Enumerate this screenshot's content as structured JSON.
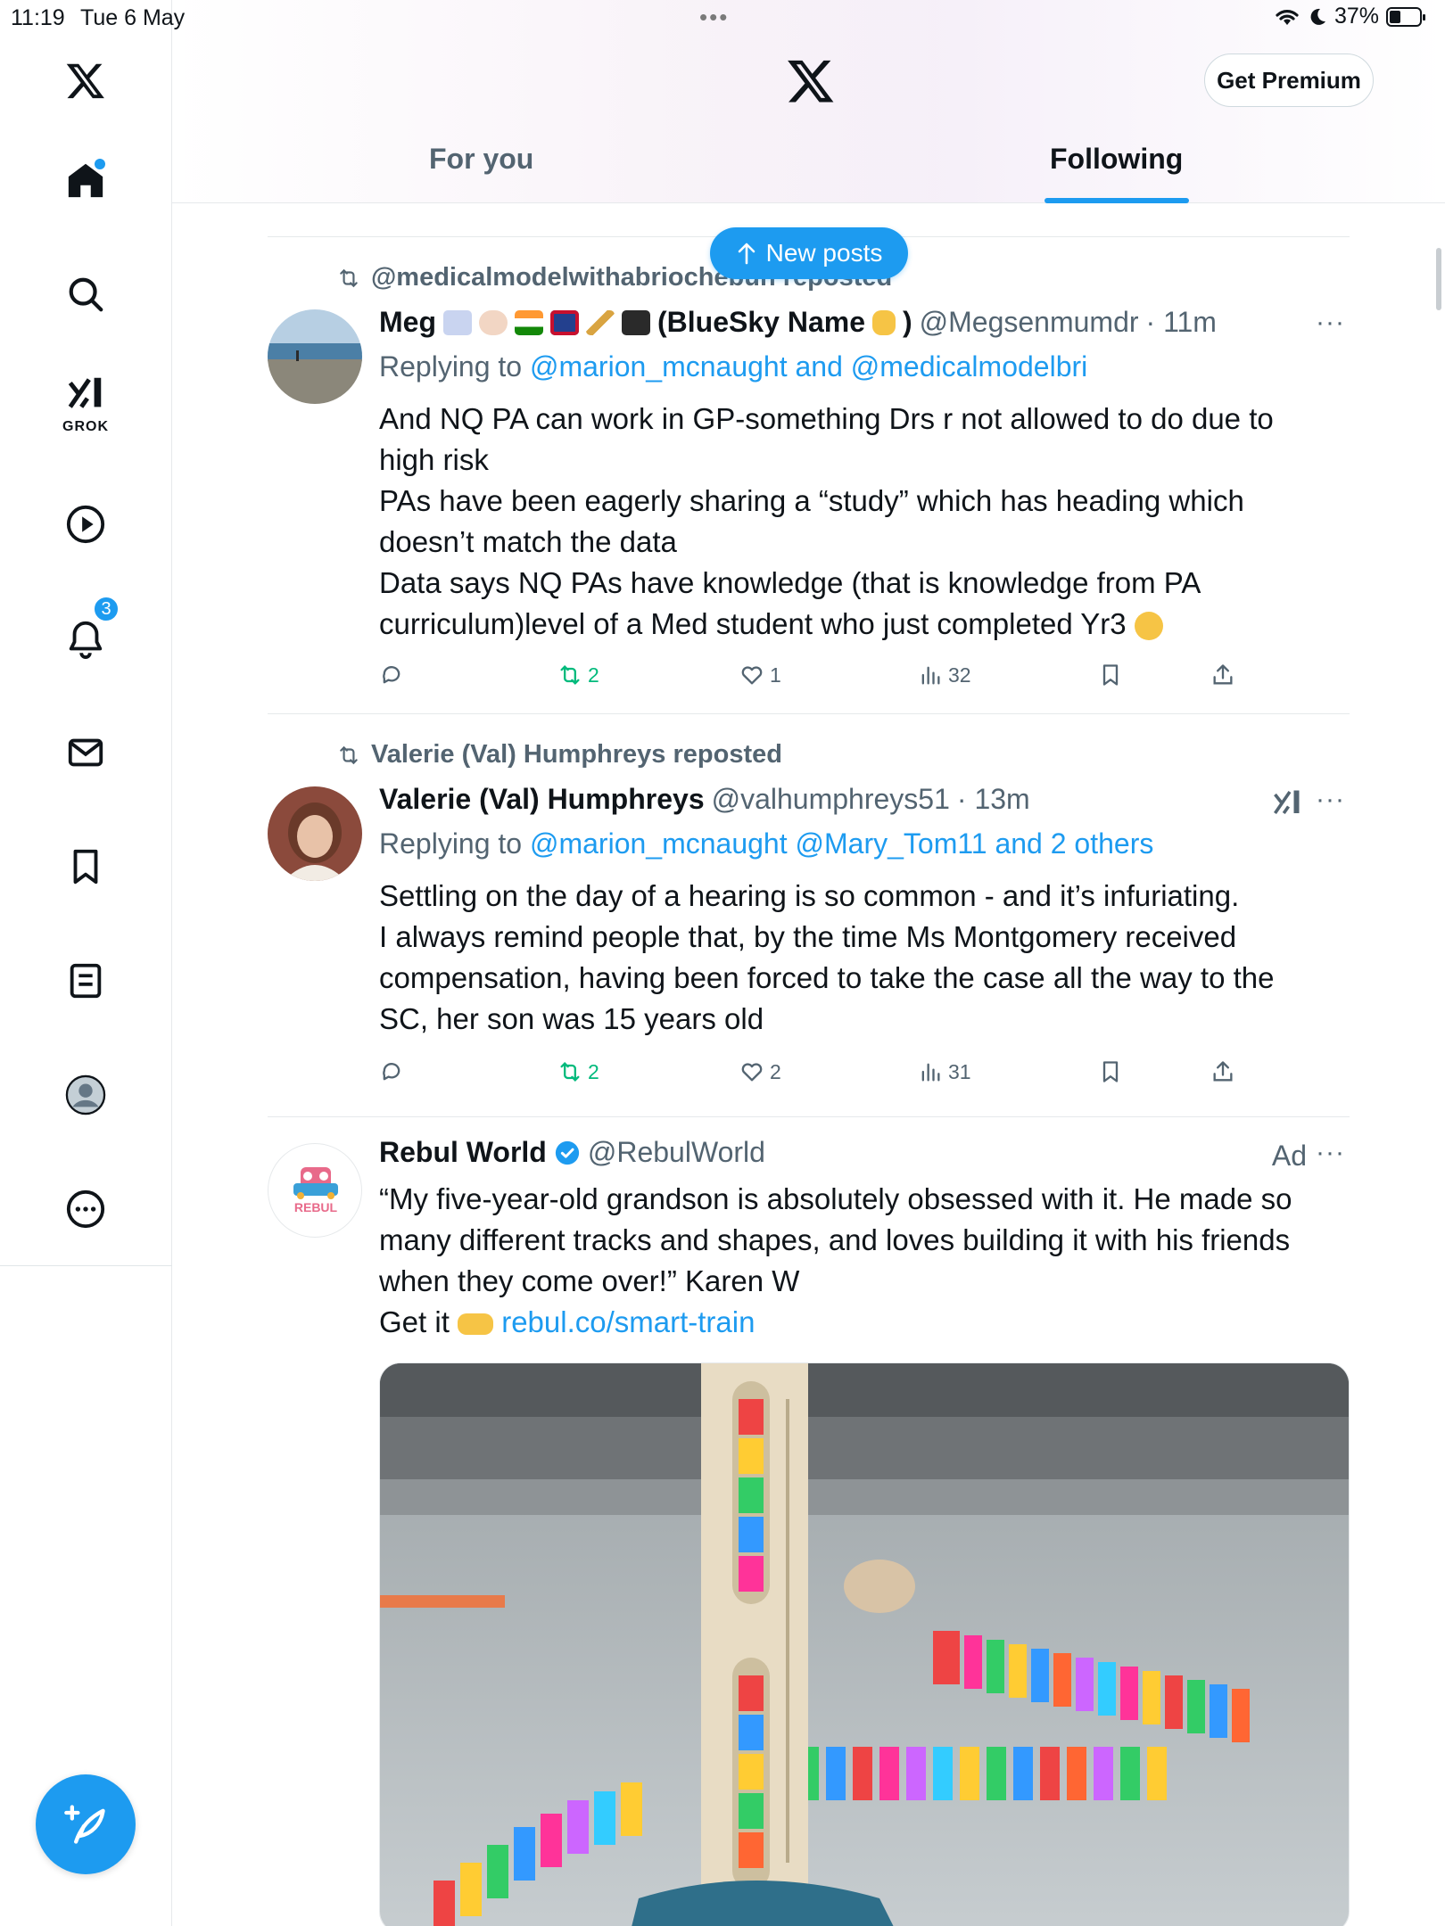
{
  "status_bar": {
    "time": "11:19",
    "date": "Tue 6 May",
    "battery": "37%",
    "battery_level": 0.37
  },
  "sidebar": {
    "grok_label": "GROK",
    "notifications_badge": "3"
  },
  "header": {
    "premium_label": "Get Premium",
    "tabs": [
      {
        "label": "For you",
        "selected": false
      },
      {
        "label": "Following",
        "selected": true
      }
    ]
  },
  "new_posts_label": "New posts",
  "posts": [
    {
      "repost_by": "@medicalmodelwithabriochebun reposted",
      "name": "Meg",
      "name_suffix": "(BlueSky Name",
      "name_end": ")",
      "handle": "@Megsenmumdr",
      "time": "· 11m",
      "replying_prefix": "Replying to ",
      "replying_to": "@marion_mcnaught and @medicalmodelbri",
      "lines": [
        "And NQ PA can work in GP-something Drs r not allowed to do due to",
        "high risk",
        "PAs have been eagerly sharing a “study” which has heading which",
        "doesn’t match the data",
        "Data says NQ PAs have knowledge (that is knowledge from PA",
        "curriculum)level of a Med student who just completed Yr3"
      ],
      "reposts": "2",
      "likes": "1",
      "views": "32"
    },
    {
      "repost_by": "Valerie (Val) Humphreys reposted",
      "name": "Valerie (Val) Humphreys",
      "handle": "@valhumphreys51",
      "time": "· 13m",
      "replying_prefix": "Replying to ",
      "replying_to": "@marion_mcnaught @Mary_Tom11 and 2 others",
      "lines": [
        "Settling on the day of a hearing is so common - and it’s infuriating.",
        "I always remind people that, by the time Ms Montgomery received",
        "compensation, having been forced to take the case all the way to the",
        "SC, her son was 15 years old"
      ],
      "reposts": "2",
      "likes": "2",
      "views": "31"
    },
    {
      "name": "Rebul World",
      "handle": "@RebulWorld",
      "ad_label": "Ad",
      "avatar_text": "REBUL",
      "lines": [
        "“My five-year-old grandson is absolutely obsessed with it. He made so",
        "many different tracks and shapes, and loves building it with his friends",
        "when they come over!” Karen W"
      ],
      "cta_prefix": "Get it ",
      "cta_link": "rebul.co/smart-train"
    }
  ],
  "colors": {
    "accent": "#1d9bf0",
    "repost_green": "#00ba7c",
    "secondary_text": "#536471"
  }
}
